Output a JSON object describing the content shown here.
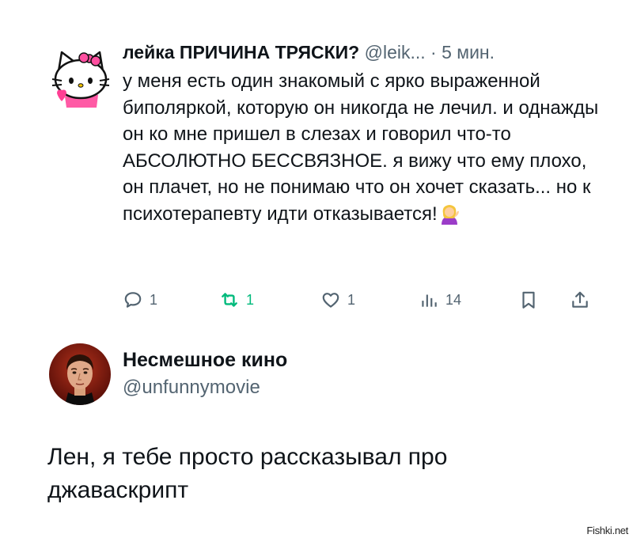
{
  "reply": {
    "author_name": "лейка ПРИЧИНА ТРЯСКИ?",
    "handle": "@leik...",
    "separator": "·",
    "time": "5 мин.",
    "text": "у меня есть один знакомый с ярко выраженной биполяркой, которую он никогда не лечил. и однажды он ко мне пришел в слезах и говорил что-то АБСОЛЮТНО БЕССВЯЗНОЕ. я вижу что ему плохо, он плачет, но не понимаю что он хочет сказать... но к психотерапевту идти отказывается!",
    "avatar_icon": "hello-kitty-avatar",
    "emoji": "woman-tipping-hand-emoji",
    "actions": {
      "replies": "1",
      "retweets": "1",
      "likes": "1",
      "views": "14"
    },
    "retweet_color": "#00ba7c"
  },
  "main": {
    "author_name": "Несмешное кино",
    "handle": "@unfunnymovie",
    "text": "Лен, я тебе просто рассказывал про джаваскрипт",
    "avatar_icon": "man-portrait-avatar"
  },
  "watermark": "Fishki.net"
}
